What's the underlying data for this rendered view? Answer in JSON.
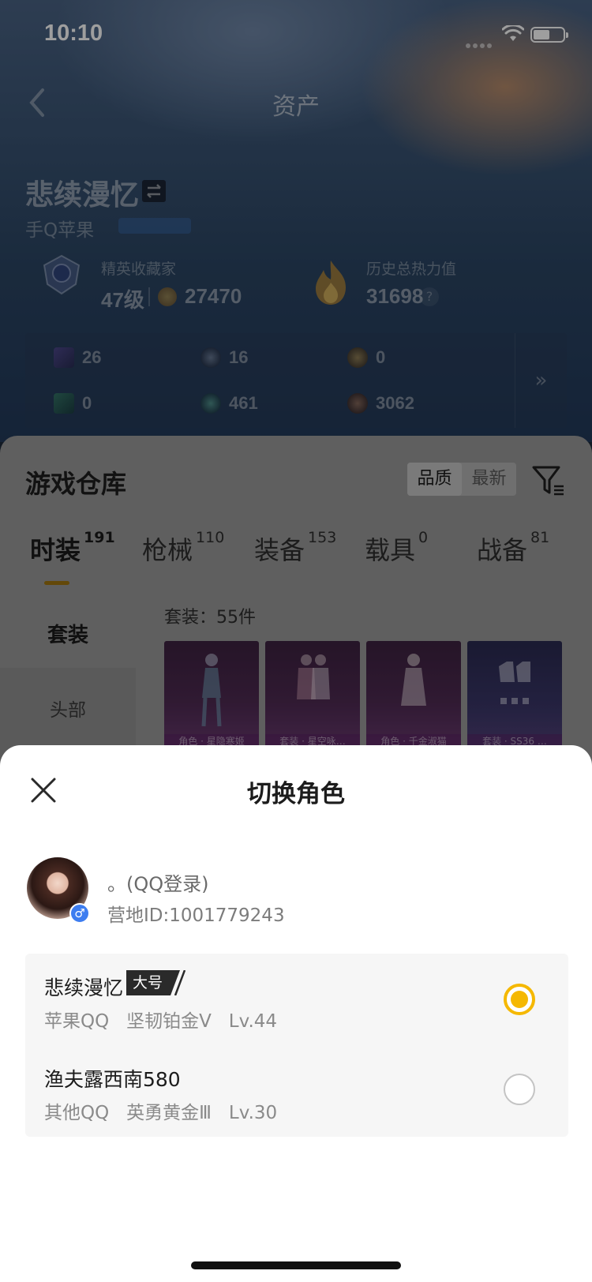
{
  "status_bar": {
    "time": "10:10"
  },
  "header": {
    "title": "资产",
    "back_icon": "chevron-left-icon"
  },
  "player": {
    "name": "悲续漫忆",
    "platform": "手Q苹果",
    "rank_label": "精英收藏家",
    "rank_level": "47级",
    "collection_points": "27470",
    "heat_label": "历史总热力值",
    "heat_value": "31698",
    "help": "?"
  },
  "resources": [
    {
      "icon": "card-pack-icon",
      "value": "26"
    },
    {
      "icon": "crate-icon",
      "value": "16"
    },
    {
      "icon": "medal-icon",
      "value": "0"
    },
    {
      "icon": "ticket-icon",
      "value": "0"
    },
    {
      "icon": "orb-icon",
      "value": "461"
    },
    {
      "icon": "bronze-coin-icon",
      "value": "3062"
    }
  ],
  "resources_more": "»",
  "warehouse": {
    "title": "游戏仓库",
    "sort_quality": "品质",
    "sort_latest": "最新",
    "tabs": [
      {
        "label": "时装",
        "count": "191"
      },
      {
        "label": "枪械",
        "count": "110"
      },
      {
        "label": "装备",
        "count": "153"
      },
      {
        "label": "载具",
        "count": "0"
      },
      {
        "label": "战备",
        "count": "81"
      }
    ],
    "side_menu": [
      "套装",
      "头部"
    ],
    "suit_count": "套装：55件",
    "items": [
      {
        "caption": "角色 · 星隐寒姬"
      },
      {
        "caption": "套装 · 星空咏…"
      },
      {
        "caption": "角色 · 千金淑猫"
      },
      {
        "caption": "套装 · SS36 …"
      }
    ]
  },
  "sheet": {
    "title": "切换角色",
    "account_name": "。(QQ登录)",
    "account_id": "营地ID:1001779243",
    "gender": "♂",
    "roles": [
      {
        "name": "悲续漫忆",
        "badge": "大号",
        "meta": "苹果QQ   坚韧铂金Ⅴ   Lv.44",
        "selected": true
      },
      {
        "name": "渔夫露西南580",
        "meta": "其他QQ   英勇黄金Ⅲ   Lv.30",
        "selected": false
      }
    ]
  },
  "colors": {
    "accent": "#f5b800",
    "overlay": "rgba(0,0,0,0.38)"
  }
}
